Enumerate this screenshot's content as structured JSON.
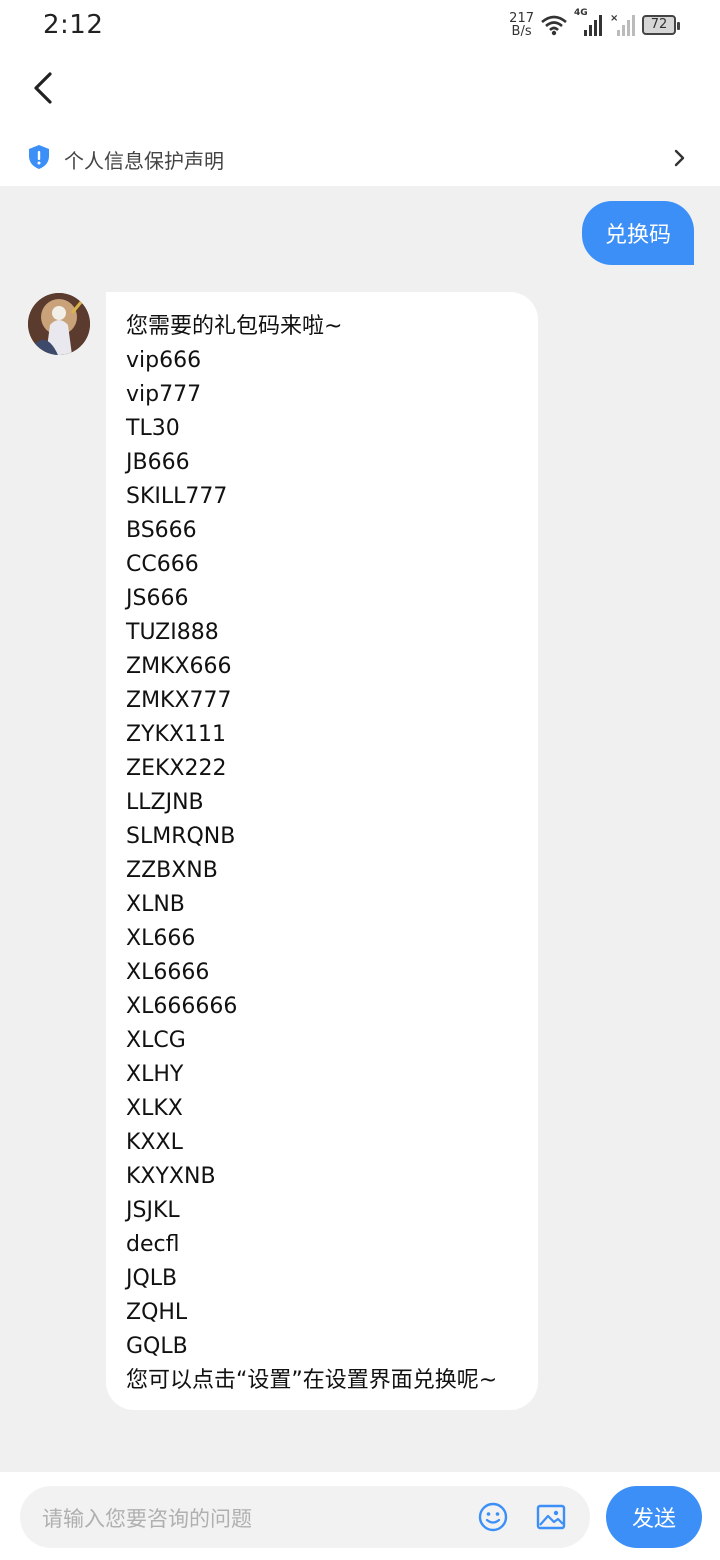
{
  "status_bar": {
    "time": "2:12",
    "net_speed_value": "217",
    "net_speed_unit": "B/s",
    "signal_label": "4G",
    "battery": "72"
  },
  "header": {
    "privacy_label": "个人信息保护声明"
  },
  "chat": {
    "user_message": "兑换码",
    "bot_lines": [
      "您需要的礼包码来啦~",
      "vip666",
      "vip777",
      "TL30",
      "JB666",
      "SKILL777",
      "BS666",
      "CC666",
      "JS666",
      "TUZI888",
      "ZMKX666",
      "ZMKX777",
      "ZYKX111",
      "ZEKX222",
      "LLZJNB",
      "SLMRQNB",
      "ZZBXNB",
      "XLNB",
      "XL666",
      "XL6666",
      "XL666666",
      "XLCG",
      "XLHY",
      "XLKX",
      "KXXL",
      "KXYXNB",
      "JSJKL",
      "decfl",
      "JQLB",
      "ZQHL",
      "GQLB",
      "您可以点击“设置”在设置界面兑换呢~"
    ]
  },
  "input_bar": {
    "placeholder": "请输入您要咨询的问题",
    "send_label": "发送"
  },
  "colors": {
    "accent": "#3b8ff7",
    "background": "#f0f0f0"
  }
}
